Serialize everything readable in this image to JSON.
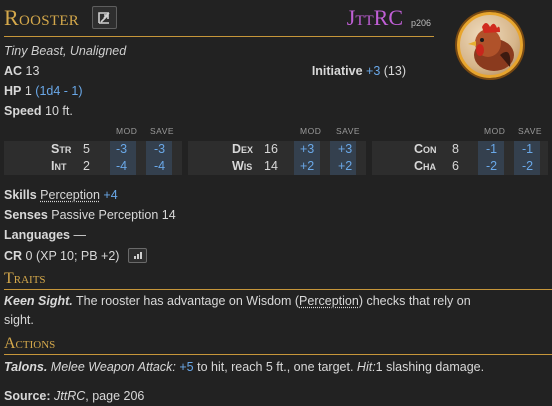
{
  "header": {
    "name": "Rooster",
    "share_icon": "share-icon",
    "source_abbr": "JttRC",
    "source_page": "p206"
  },
  "meta": {
    "type_line": "Tiny Beast, Unaligned"
  },
  "stats": {
    "ac_label": "AC",
    "ac": "13",
    "init_label": "Initiative",
    "init_mod": "+3",
    "init_score": "(13)",
    "hp_label": "HP",
    "hp_value": "1",
    "hp_formula": "(1d4 - 1)",
    "speed_label": "Speed",
    "speed": "10 ft."
  },
  "abilities": {
    "mod_header": "MOD",
    "save_header": "SAVE",
    "list": [
      {
        "name": "Str",
        "score": "5",
        "mod": "-3",
        "save": "-3"
      },
      {
        "name": "Int",
        "score": "2",
        "mod": "-4",
        "save": "-4"
      },
      {
        "name": "Dex",
        "score": "16",
        "mod": "+3",
        "save": "+3"
      },
      {
        "name": "Wis",
        "score": "14",
        "mod": "+2",
        "save": "+2"
      },
      {
        "name": "Con",
        "score": "8",
        "mod": "-1",
        "save": "-1"
      },
      {
        "name": "Cha",
        "score": "6",
        "mod": "-2",
        "save": "-2"
      }
    ]
  },
  "details": {
    "skills_label": "Skills",
    "skills_name": "Perception",
    "skills_mod": "+4",
    "senses_label": "Senses",
    "senses": "Passive Perception 14",
    "languages_label": "Languages",
    "languages": "—",
    "cr_label": "CR",
    "cr": "0 (XP 10; PB +2)",
    "cr_icon": "bar-chart-icon"
  },
  "traits": {
    "title": "Traits",
    "keen_name": "Keen Sight.",
    "keen_pre": "The rooster has advantage on Wisdom (",
    "keen_link": "Perception",
    "keen_post": ") checks that rely on",
    "keen_line2": "sight."
  },
  "actions": {
    "title": "Actions",
    "talons_name": "Talons.",
    "talons_type": "Melee Weapon Attack:",
    "talons_bonus": "+5",
    "talons_mid": "to hit, reach 5 ft., one target.",
    "talons_hit": "Hit:",
    "talons_dmg": "1 slashing damage."
  },
  "source": {
    "label": "Source:",
    "book": "JttRC",
    "page": ", page 206"
  }
}
